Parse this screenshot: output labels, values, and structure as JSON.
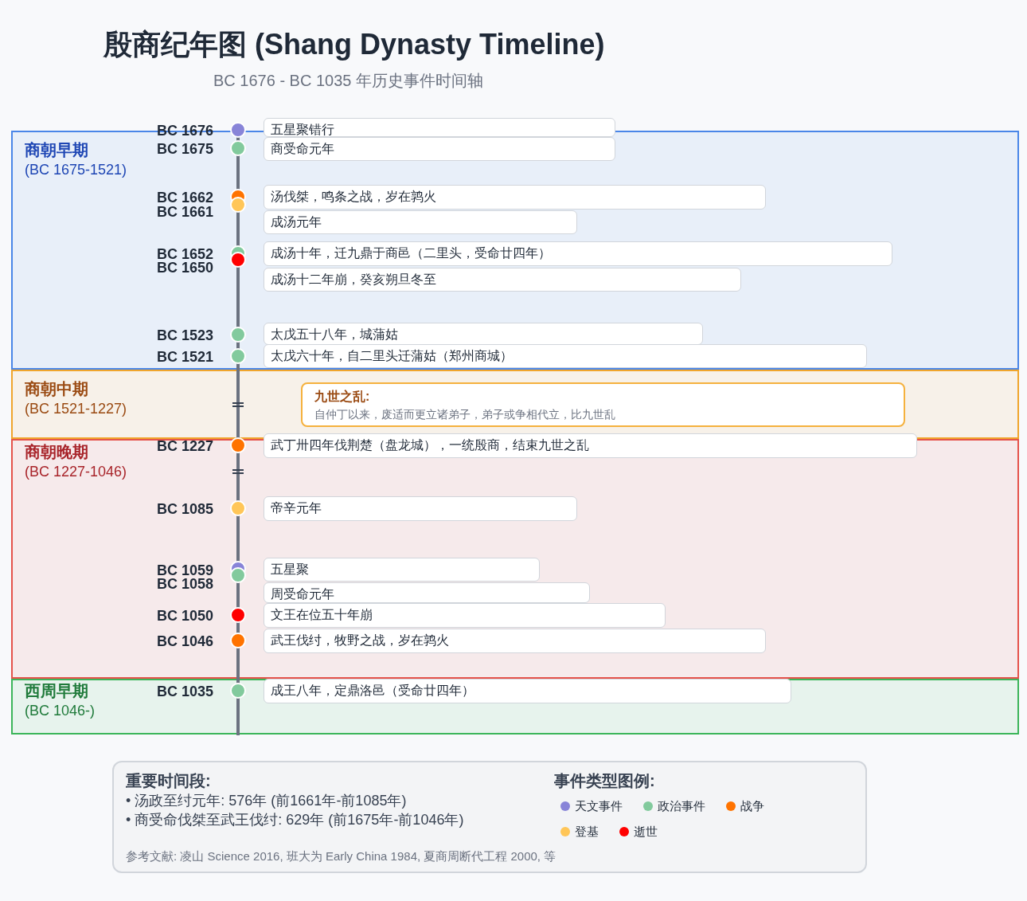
{
  "title": "殷商纪年图 (Shang Dynasty Timeline)",
  "subtitle": "BC 1676 - BC 1035 年历史事件时间轴",
  "periods": [
    {
      "name": "商朝早期",
      "range": "(BC 1675-1521)",
      "color": "#4a86e8"
    },
    {
      "name": "商朝中期",
      "range": "(BC 1521-1227)",
      "color": "#f0a52c"
    },
    {
      "name": "商朝晚期",
      "range": "(BC 1227-1046)",
      "color": "#e5534b"
    },
    {
      "name": "西周早期",
      "range": "(BC 1046-)",
      "color": "#3cb55a"
    }
  ],
  "events": [
    {
      "date": "BC 1676",
      "text": "五星聚错行",
      "color": "#8884d8"
    },
    {
      "date": "BC 1675",
      "text": "商受命元年",
      "color": "#82ca9d"
    },
    {
      "date": "BC 1662",
      "text": "汤伐桀，鸣条之战，岁在鹑火",
      "color": "#ff7300"
    },
    {
      "date": "BC 1661",
      "text": "成汤元年",
      "color": "#ffc658"
    },
    {
      "date": "BC 1652",
      "text": "成汤十年，迁九鼎于商邑（二里头，受命廿四年）",
      "color": "#82ca9d"
    },
    {
      "date": "BC 1650",
      "text": "成汤十二年崩，癸亥朔旦冬至",
      "color": "#ff0000"
    },
    {
      "date": "BC 1523",
      "text": "太戊五十八年，城蒲姑",
      "color": "#82ca9d"
    },
    {
      "date": "BC 1521",
      "text": "太戊六十年，自二里头迁蒲姑（郑州商城）",
      "color": "#82ca9d"
    },
    {
      "date": "BC 1227",
      "text": "武丁卅四年伐荆楚（盘龙城），一统殷商，结束九世之乱",
      "color": "#ff7300"
    },
    {
      "date": "BC 1085",
      "text": "帝辛元年",
      "color": "#ffc658"
    },
    {
      "date": "BC 1059",
      "text": "五星聚",
      "color": "#8884d8"
    },
    {
      "date": "BC 1058",
      "text": "周受命元年",
      "color": "#82ca9d"
    },
    {
      "date": "BC 1050",
      "text": "文王在位五十年崩",
      "color": "#ff0000"
    },
    {
      "date": "BC 1046",
      "text": "武王伐纣，牧野之战，岁在鹑火",
      "color": "#ff7300"
    },
    {
      "date": "BC 1035",
      "text": "成王八年，定鼎洛邑（受命廿四年）",
      "color": "#82ca9d"
    }
  ],
  "period_note": {
    "title": "九世之乱:",
    "text": "自仲丁以来，废适而更立诸弟子，弟子或争相代立，比九世乱"
  },
  "summary": {
    "title": "重要时间段:",
    "items": [
      "• 汤政至纣元年: 576年 (前1661年-前1085年)",
      "• 商受命伐桀至武王伐纣: 629年 (前1675年-前1046年)"
    ],
    "reference": "参考文献: 凌山 Science 2016, 班大为 Early China 1984, 夏商周断代工程 2000, 等"
  },
  "legend": {
    "title": "事件类型图例:",
    "items": [
      {
        "label": "天文事件",
        "color": "#8884d8"
      },
      {
        "label": "政治事件",
        "color": "#82ca9d"
      },
      {
        "label": "战争",
        "color": "#ff7300"
      },
      {
        "label": "登基",
        "color": "#ffc658"
      },
      {
        "label": "逝世",
        "color": "#ff0000"
      }
    ]
  }
}
